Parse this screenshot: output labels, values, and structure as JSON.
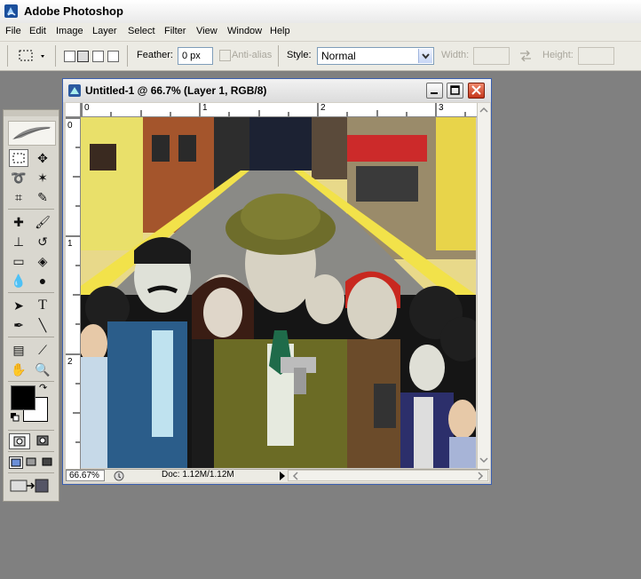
{
  "app": {
    "title": "Adobe Photoshop"
  },
  "menu": [
    "File",
    "Edit",
    "Image",
    "Layer",
    "Select",
    "Filter",
    "View",
    "Window",
    "Help"
  ],
  "options": {
    "feather_label": "Feather:",
    "feather_value": "0 px",
    "antialias_label": "Anti-alias",
    "style_label": "Style:",
    "style_value": "Normal",
    "width_label": "Width:",
    "height_label": "Height:"
  },
  "document": {
    "title": "Untitled-1 @ 66.7% (Layer 1, RGB/8)",
    "ruler_top": [
      "0",
      "1",
      "2",
      "3"
    ],
    "ruler_left": [
      "0",
      "1",
      "2"
    ],
    "zoom": "66.67%",
    "doc_info": "Doc: 1.12M/1.12M"
  },
  "toolbox": {
    "tools": [
      "marquee-tool-icon",
      "move-tool-icon",
      "lasso-tool-icon",
      "magic-wand-tool-icon",
      "crop-tool-icon",
      "slice-tool-icon",
      "healing-brush-tool-icon",
      "brush-tool-icon",
      "clone-stamp-tool-icon",
      "history-brush-tool-icon",
      "eraser-tool-icon",
      "paint-bucket-tool-icon",
      "blur-tool-icon",
      "dodge-tool-icon",
      "path-selection-tool-icon",
      "type-tool-icon",
      "pen-tool-icon",
      "line-tool-icon",
      "notes-tool-icon",
      "eyedropper-tool-icon",
      "hand-tool-icon",
      "zoom-tool-icon"
    ]
  },
  "colors": {
    "foreground": "#000000",
    "background": "#ffffff",
    "close_button": "#c4361b"
  }
}
